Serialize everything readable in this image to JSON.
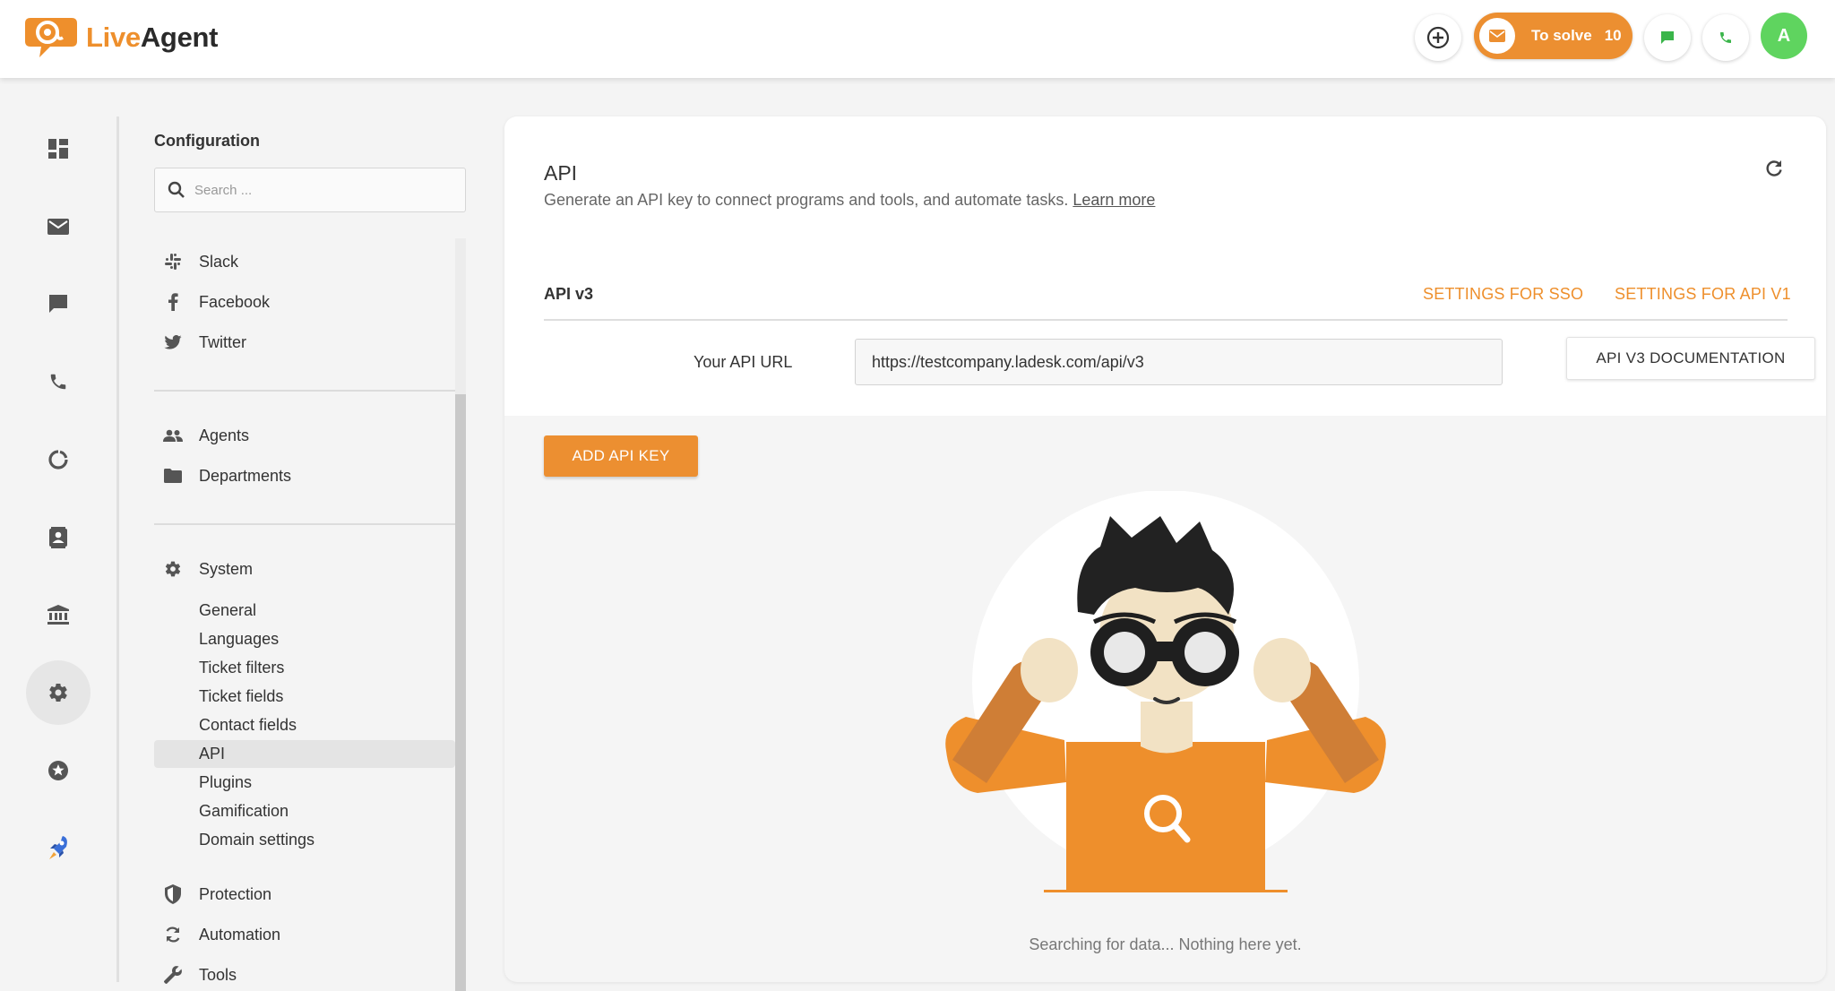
{
  "app": {
    "logo_live": "Live",
    "logo_agent": "Agent"
  },
  "topbar": {
    "to_solve_label": "To solve",
    "to_solve_count": "10",
    "avatar_initial": "A"
  },
  "rail": {
    "items": [
      "dashboard-icon",
      "email-icon",
      "chat-icon",
      "phone-icon",
      "reports-icon",
      "contacts-icon",
      "knowledgebase-icon",
      "settings-icon",
      "gamification-icon",
      "rocket-icon"
    ],
    "active": "settings-icon"
  },
  "config": {
    "title": "Configuration",
    "search_placeholder": "Search ...",
    "group1": [
      {
        "label": "Slack",
        "icon": "slack-icon"
      },
      {
        "label": "Facebook",
        "icon": "facebook-icon"
      },
      {
        "label": "Twitter",
        "icon": "twitter-icon"
      }
    ],
    "group2": [
      {
        "label": "Agents",
        "icon": "agents-icon"
      },
      {
        "label": "Departments",
        "icon": "folder-icon"
      }
    ],
    "system_label": "System",
    "system_items": [
      "General",
      "Languages",
      "Ticket filters",
      "Ticket fields",
      "Contact fields",
      "API",
      "Plugins",
      "Gamification",
      "Domain settings"
    ],
    "active_item": "API",
    "group3": [
      {
        "label": "Protection",
        "icon": "shield-icon"
      },
      {
        "label": "Automation",
        "icon": "sync-icon"
      },
      {
        "label": "Tools",
        "icon": "wrench-icon"
      }
    ]
  },
  "main": {
    "title": "API",
    "description": "Generate an API key to connect programs and tools, and automate tasks.",
    "learn_more": "Learn more",
    "section_label": "API v3",
    "sso_link": "SETTINGS FOR SSO",
    "v1_link": "SETTINGS FOR API V1",
    "url_label": "Your API URL",
    "api_url": "https://testcompany.ladesk.com/api/v3",
    "doc_button": "API V3 DOCUMENTATION",
    "add_key_button": "ADD API KEY",
    "empty_message": "Searching for data... Nothing here yet."
  },
  "colors": {
    "accent": "#ec8f31",
    "avatar": "#5fd45f",
    "text": "#333333"
  }
}
